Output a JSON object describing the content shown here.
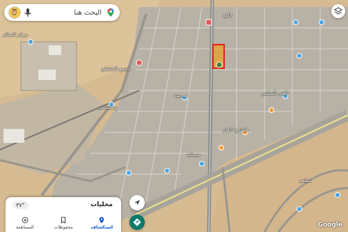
{
  "search": {
    "placeholder": "البحث هنا",
    "avatar": "🦉"
  },
  "map_labels": [
    {
      "text": "مركز السلام"
    },
    {
      "text": "مجمع الشاطئ"
    },
    {
      "text": "جامع"
    },
    {
      "text": "مدرسة"
    },
    {
      "text": "مستشفى"
    },
    {
      "text": "الحي السكني"
    },
    {
      "text": "الشارع العام"
    },
    {
      "text": "صيدلية"
    },
    {
      "text": "مطعم"
    }
  ],
  "sheet": {
    "title": "محليات",
    "weather": "٣٧°"
  },
  "tabs": [
    {
      "label": "استكشاف",
      "icon": "pin-icon",
      "active": true
    },
    {
      "label": "محفوظات",
      "icon": "bookmark-icon",
      "active": false
    },
    {
      "label": "المساهمة",
      "icon": "add-circle-icon",
      "active": false
    }
  ],
  "logo": "Google"
}
